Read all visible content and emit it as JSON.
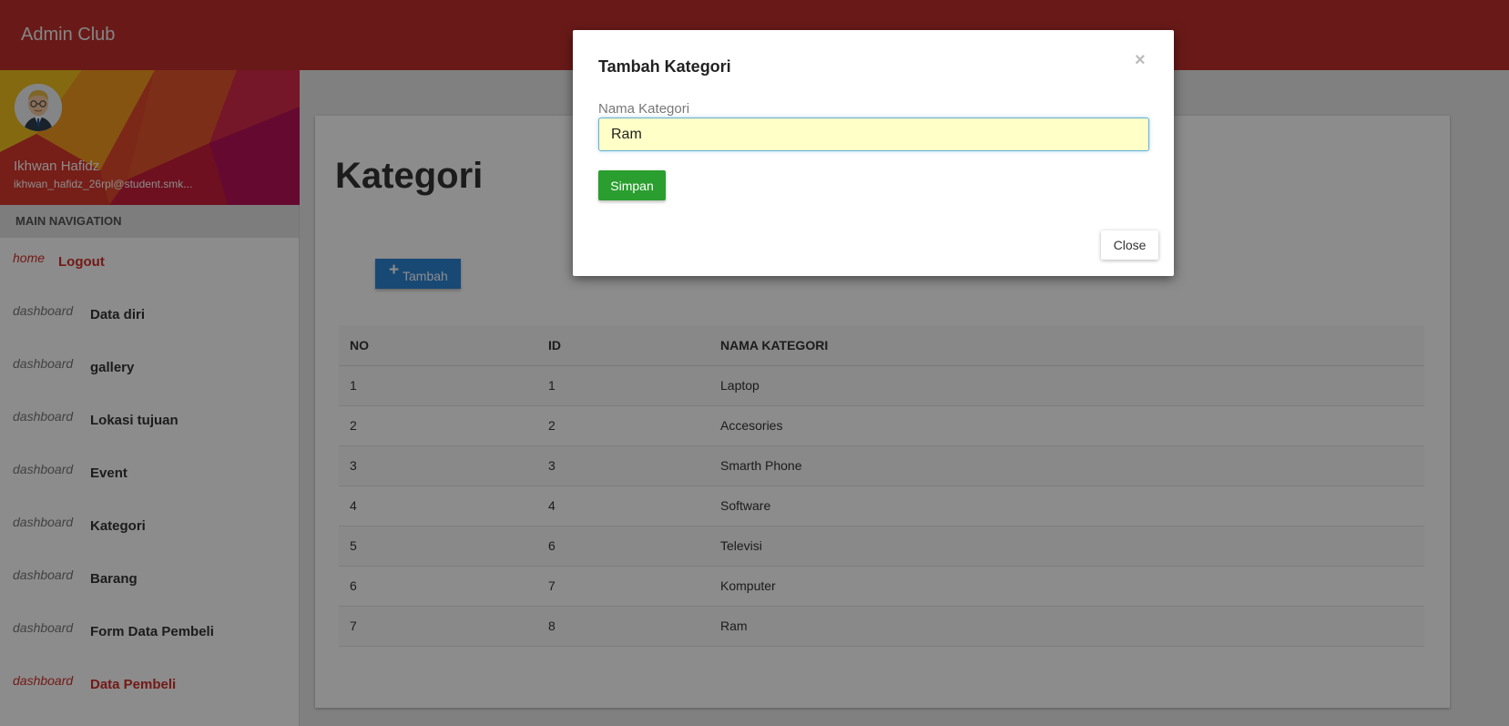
{
  "header": {
    "brand": "Admin Club"
  },
  "colors": {
    "topbar": "#c0302c",
    "primary": "#2c86d6",
    "success": "#2a9e2e",
    "active": "#d0302b"
  },
  "profile": {
    "name": "Ikhwan Hafidz",
    "email": "ikhwan_hafidz_26rpl@student.smk..."
  },
  "sidebar": {
    "heading": "MAIN NAVIGATION",
    "items": [
      {
        "icon": "home",
        "label": "Logout"
      },
      {
        "icon": "dashboard",
        "label": "Data diri"
      },
      {
        "icon": "dashboard",
        "label": "gallery"
      },
      {
        "icon": "dashboard",
        "label": "Lokasi tujuan"
      },
      {
        "icon": "dashboard",
        "label": "Event"
      },
      {
        "icon": "dashboard",
        "label": "Kategori"
      },
      {
        "icon": "dashboard",
        "label": "Barang"
      },
      {
        "icon": "dashboard",
        "label": "Form Data Pembeli"
      },
      {
        "icon": "dashboard",
        "label": "Data Pembeli"
      }
    ]
  },
  "main": {
    "title": "Kategori",
    "add_button": {
      "icon": "+",
      "label": "Tambah"
    },
    "table": {
      "headers": [
        "NO",
        "ID",
        "NAMA KATEGORI"
      ],
      "rows": [
        [
          "1",
          "1",
          "Laptop"
        ],
        [
          "2",
          "2",
          "Accesories"
        ],
        [
          "3",
          "3",
          "Smarth Phone"
        ],
        [
          "4",
          "4",
          "Software"
        ],
        [
          "5",
          "6",
          "Televisi"
        ],
        [
          "6",
          "7",
          "Komputer"
        ],
        [
          "7",
          "8",
          "Ram"
        ]
      ]
    }
  },
  "modal": {
    "title": "Tambah Kategori",
    "close_x": "×",
    "field_label": "Nama Kategori",
    "field_value": "Ram",
    "save_label": "Simpan",
    "close_label": "Close"
  }
}
